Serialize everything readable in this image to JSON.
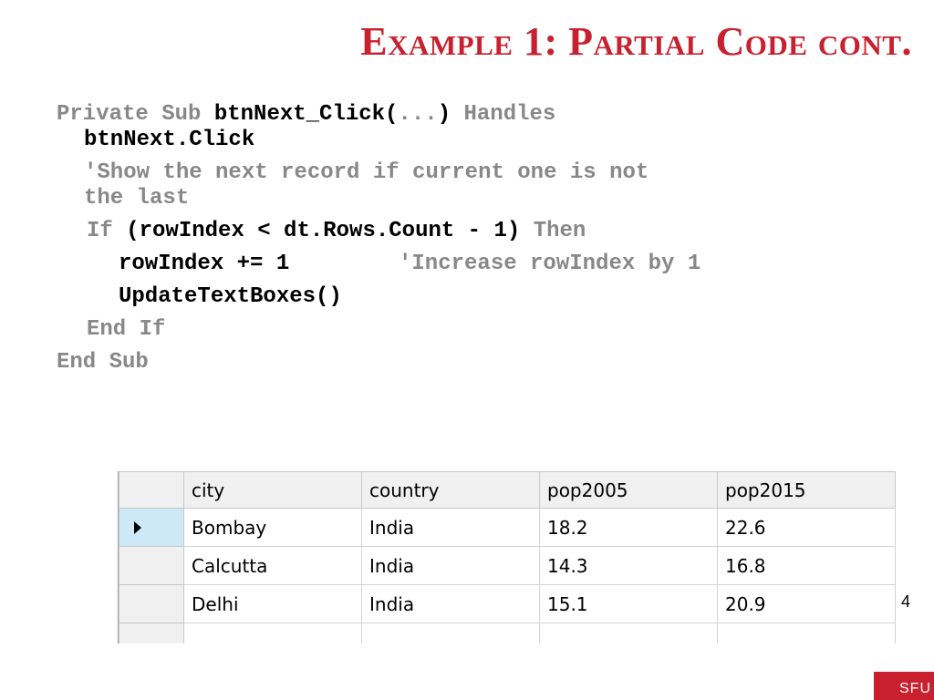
{
  "slide": {
    "title": "Example 1: Partial Code cont.",
    "page_number": "4",
    "logo_text": "SFU"
  },
  "code": {
    "l1_kw": "Private Sub ",
    "l1_name": "btnNext_Click(",
    "l1_args": "...",
    "l1_close": ") ",
    "l1_handles": "Handles",
    "l2": "btnNext.Click",
    "l3": "'Show the next record if current one is not",
    "l4": "the last",
    "l5_if": "If ",
    "l5_cond": "(rowIndex < dt.Rows.Count - 1) ",
    "l5_then": "Then",
    "l6_code": "rowIndex += 1",
    "l6_comment": "'Increase rowIndex by 1",
    "l7": "UpdateTextBoxes()",
    "l8": "End If",
    "l9": "End Sub"
  },
  "grid": {
    "columns": [
      "city",
      "country",
      "pop2005",
      "pop2015"
    ],
    "rows": [
      [
        "Bombay",
        "India",
        "18.2",
        "22.6"
      ],
      [
        "Calcutta",
        "India",
        "14.3",
        "16.8"
      ],
      [
        "Delhi",
        "India",
        "15.1",
        "20.9"
      ]
    ]
  }
}
